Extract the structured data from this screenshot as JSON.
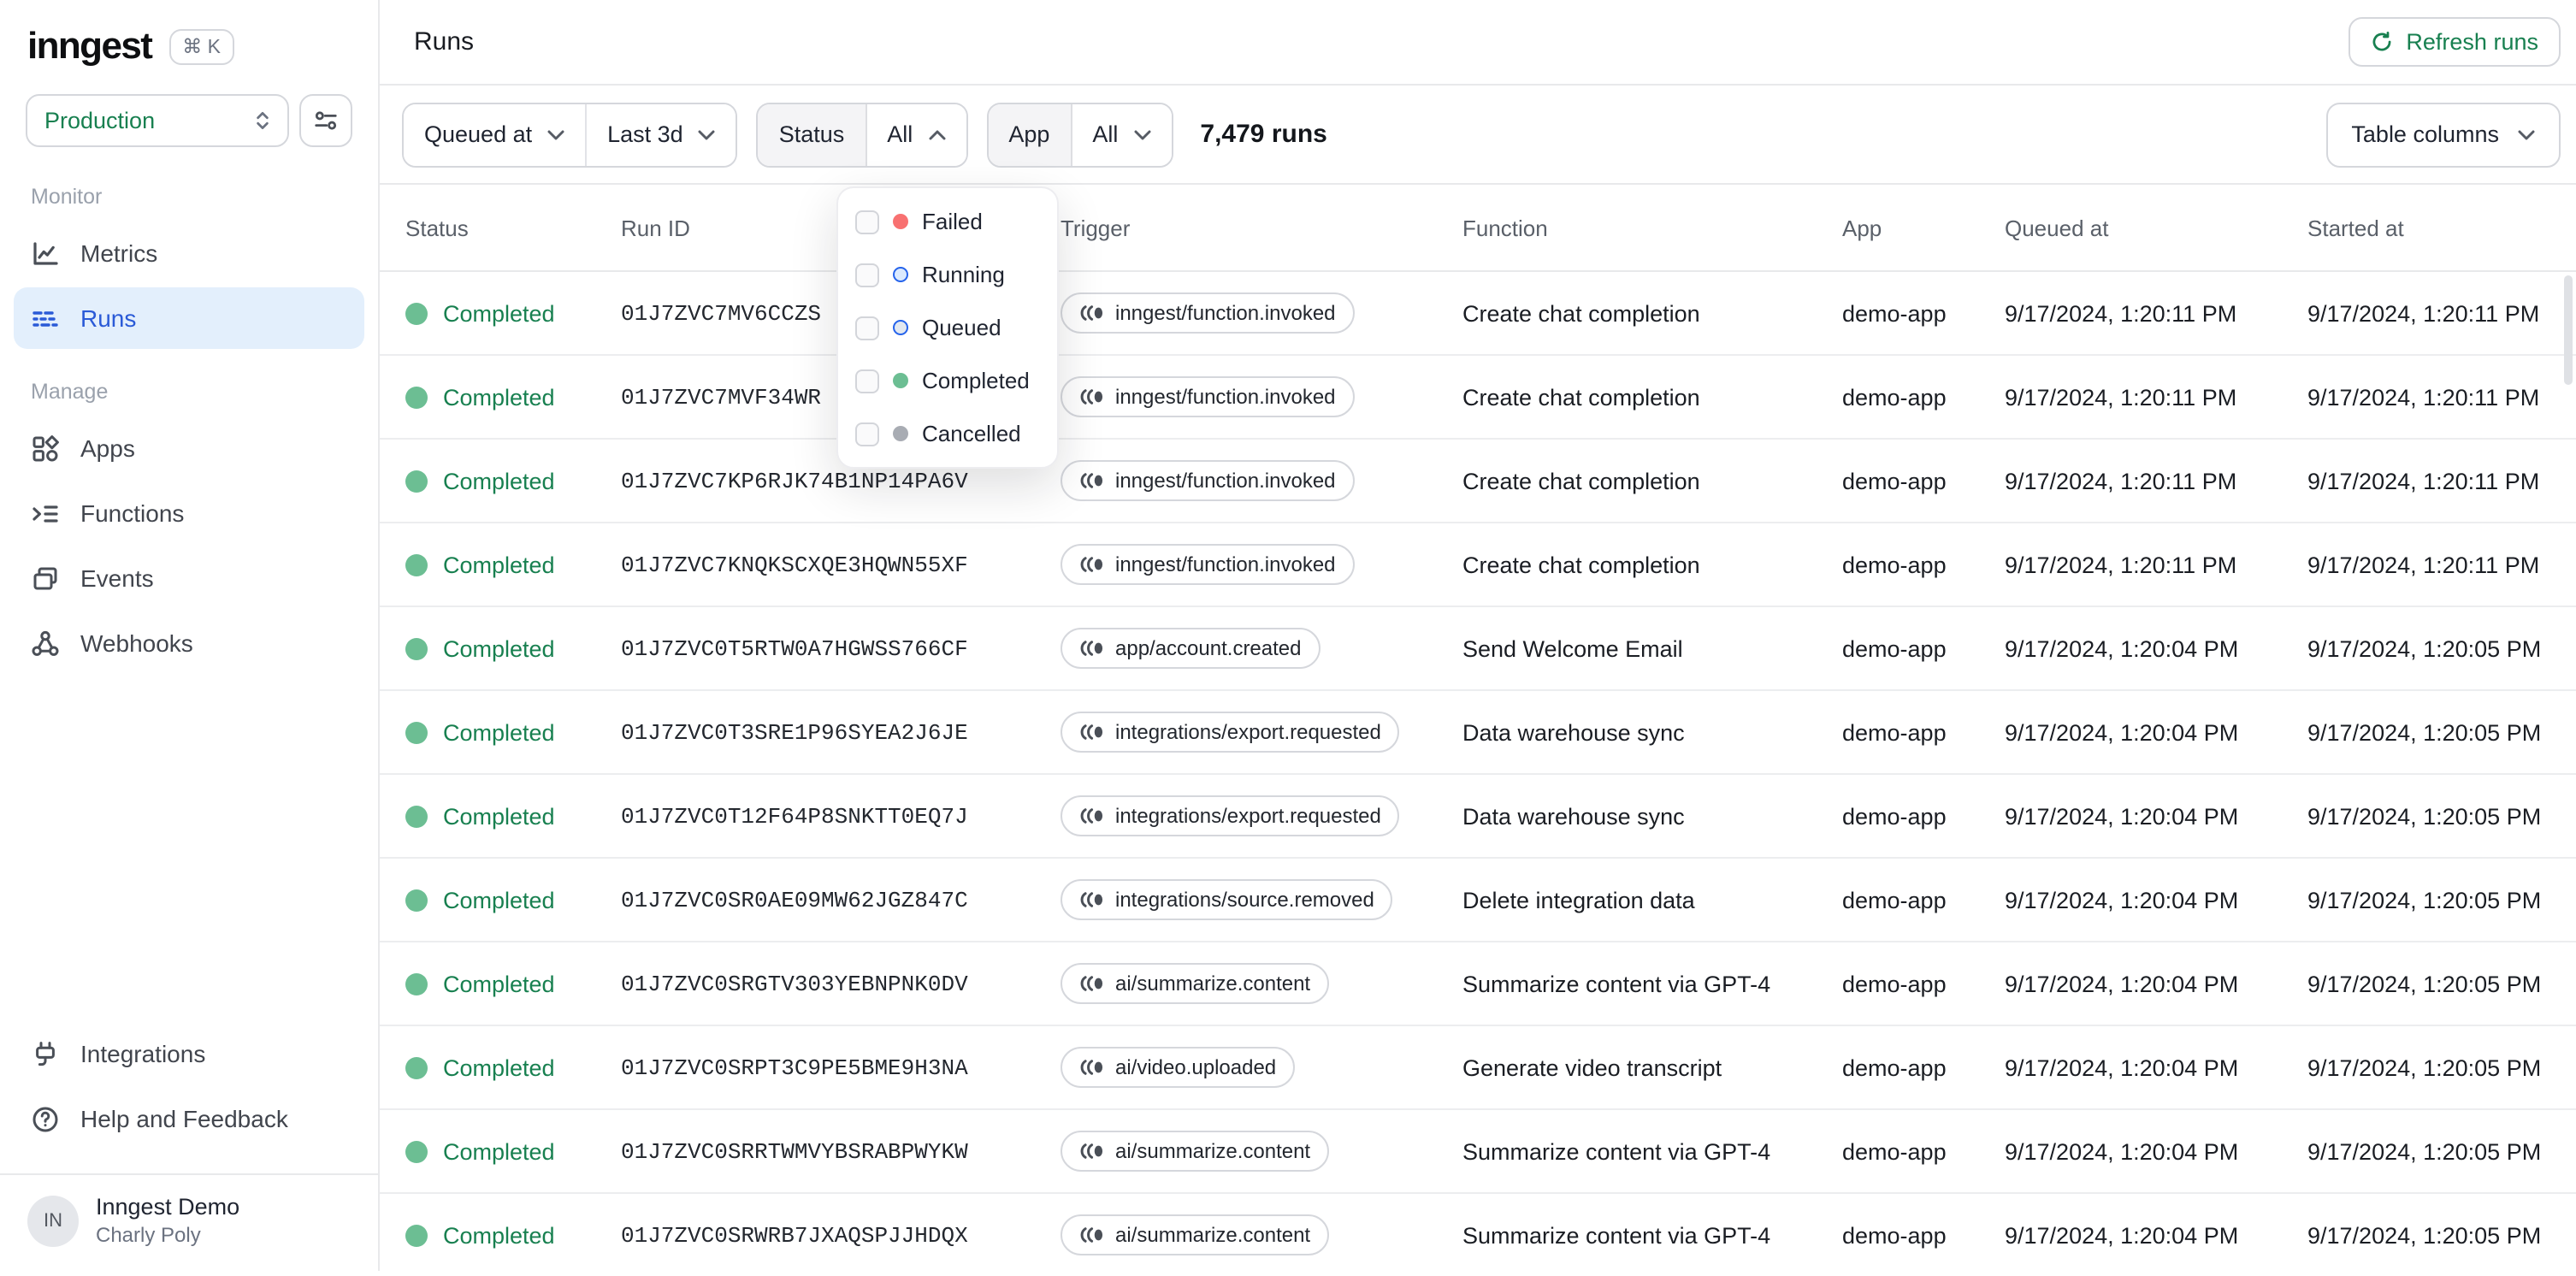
{
  "brand": {
    "logo": "inngest",
    "shortcut": "⌘ K"
  },
  "sidebar": {
    "environment": {
      "value": "Production"
    },
    "sections": [
      {
        "label": "Monitor",
        "items": [
          {
            "label": "Metrics",
            "icon": "metrics",
            "active": false
          },
          {
            "label": "Runs",
            "icon": "runs",
            "active": true
          }
        ]
      },
      {
        "label": "Manage",
        "items": [
          {
            "label": "Apps",
            "icon": "apps",
            "active": false
          },
          {
            "label": "Functions",
            "icon": "functions",
            "active": false
          },
          {
            "label": "Events",
            "icon": "events",
            "active": false
          },
          {
            "label": "Webhooks",
            "icon": "webhooks",
            "active": false
          }
        ]
      }
    ],
    "footer_items": [
      {
        "label": "Integrations",
        "icon": "integrations"
      },
      {
        "label": "Help and Feedback",
        "icon": "help"
      }
    ],
    "user": {
      "initials": "IN",
      "org": "Inngest Demo",
      "name": "Charly Poly"
    }
  },
  "header": {
    "title": "Runs",
    "refresh_label": "Refresh runs"
  },
  "filterbar": {
    "queued_at_label": "Queued at",
    "time_range_value": "Last 3d",
    "status_label": "Status",
    "status_value": "All",
    "app_label": "App",
    "app_value": "All",
    "runs_count": "7,479 runs",
    "table_columns_label": "Table columns"
  },
  "status_menu": {
    "options": [
      {
        "label": "Failed",
        "dot_style": "filled",
        "dot_color": "#F87171",
        "dot_fill": "#F87171"
      },
      {
        "label": "Running",
        "dot_style": "ring",
        "dot_color": "#2563EB",
        "dot_fill": "#DBEAFE"
      },
      {
        "label": "Queued",
        "dot_style": "ring",
        "dot_color": "#2563EB",
        "dot_fill": "#E2E8F0"
      },
      {
        "label": "Completed",
        "dot_style": "filled",
        "dot_color": "#6CBE93",
        "dot_fill": "#6CBE93"
      },
      {
        "label": "Cancelled",
        "dot_style": "filled",
        "dot_color": "#A8ACB3",
        "dot_fill": "#A8ACB3"
      }
    ]
  },
  "table": {
    "columns": [
      "Status",
      "Run ID",
      "Trigger",
      "Function",
      "App",
      "Queued at",
      "Started at"
    ],
    "rows": [
      {
        "status": "Completed",
        "run_id": "01J7ZVC7MV6CCZS",
        "trigger": "inngest/function.invoked",
        "function": "Create chat completion",
        "app": "demo-app",
        "queued_at": "9/17/2024, 1:20:11 PM",
        "started_at": "9/17/2024, 1:20:11 PM"
      },
      {
        "status": "Completed",
        "run_id": "01J7ZVC7MVF34WR",
        "trigger": "inngest/function.invoked",
        "function": "Create chat completion",
        "app": "demo-app",
        "queued_at": "9/17/2024, 1:20:11 PM",
        "started_at": "9/17/2024, 1:20:11 PM"
      },
      {
        "status": "Completed",
        "run_id": "01J7ZVC7KP6RJK74B1NP14PA6V",
        "trigger": "inngest/function.invoked",
        "function": "Create chat completion",
        "app": "demo-app",
        "queued_at": "9/17/2024, 1:20:11 PM",
        "started_at": "9/17/2024, 1:20:11 PM"
      },
      {
        "status": "Completed",
        "run_id": "01J7ZVC7KNQKSCXQE3HQWN55XF",
        "trigger": "inngest/function.invoked",
        "function": "Create chat completion",
        "app": "demo-app",
        "queued_at": "9/17/2024, 1:20:11 PM",
        "started_at": "9/17/2024, 1:20:11 PM"
      },
      {
        "status": "Completed",
        "run_id": "01J7ZVC0T5RTW0A7HGWSS766CF",
        "trigger": "app/account.created",
        "function": "Send Welcome Email",
        "app": "demo-app",
        "queued_at": "9/17/2024, 1:20:04 PM",
        "started_at": "9/17/2024, 1:20:05 PM"
      },
      {
        "status": "Completed",
        "run_id": "01J7ZVC0T3SRE1P96SYEA2J6JE",
        "trigger": "integrations/export.requested",
        "function": "Data warehouse sync",
        "app": "demo-app",
        "queued_at": "9/17/2024, 1:20:04 PM",
        "started_at": "9/17/2024, 1:20:05 PM"
      },
      {
        "status": "Completed",
        "run_id": "01J7ZVC0T12F64P8SNKTT0EQ7J",
        "trigger": "integrations/export.requested",
        "function": "Data warehouse sync",
        "app": "demo-app",
        "queued_at": "9/17/2024, 1:20:04 PM",
        "started_at": "9/17/2024, 1:20:05 PM"
      },
      {
        "status": "Completed",
        "run_id": "01J7ZVC0SR0AE09MW62JGZ847C",
        "trigger": "integrations/source.removed",
        "function": "Delete integration data",
        "app": "demo-app",
        "queued_at": "9/17/2024, 1:20:04 PM",
        "started_at": "9/17/2024, 1:20:05 PM"
      },
      {
        "status": "Completed",
        "run_id": "01J7ZVC0SRGTV303YEBNPNK0DV",
        "trigger": "ai/summarize.content",
        "function": "Summarize content via GPT-4",
        "app": "demo-app",
        "queued_at": "9/17/2024, 1:20:04 PM",
        "started_at": "9/17/2024, 1:20:05 PM"
      },
      {
        "status": "Completed",
        "run_id": "01J7ZVC0SRPT3C9PE5BME9H3NA",
        "trigger": "ai/video.uploaded",
        "function": "Generate video transcript",
        "app": "demo-app",
        "queued_at": "9/17/2024, 1:20:04 PM",
        "started_at": "9/17/2024, 1:20:05 PM"
      },
      {
        "status": "Completed",
        "run_id": "01J7ZVC0SRRTWMVYBSRABPWYKW",
        "trigger": "ai/summarize.content",
        "function": "Summarize content via GPT-4",
        "app": "demo-app",
        "queued_at": "9/17/2024, 1:20:04 PM",
        "started_at": "9/17/2024, 1:20:05 PM"
      },
      {
        "status": "Completed",
        "run_id": "01J7ZVC0SRWRB7JXAQSPJJHDQX",
        "trigger": "ai/summarize.content",
        "function": "Summarize content via GPT-4",
        "app": "demo-app",
        "queued_at": "9/17/2024, 1:20:04 PM",
        "started_at": "9/17/2024, 1:20:05 PM"
      }
    ]
  },
  "colors": {
    "accent_green": "#188050",
    "status_dot_green": "#6CBE93",
    "active_nav_bg": "#E3EFFC",
    "active_nav_text": "#2A5AD7"
  }
}
